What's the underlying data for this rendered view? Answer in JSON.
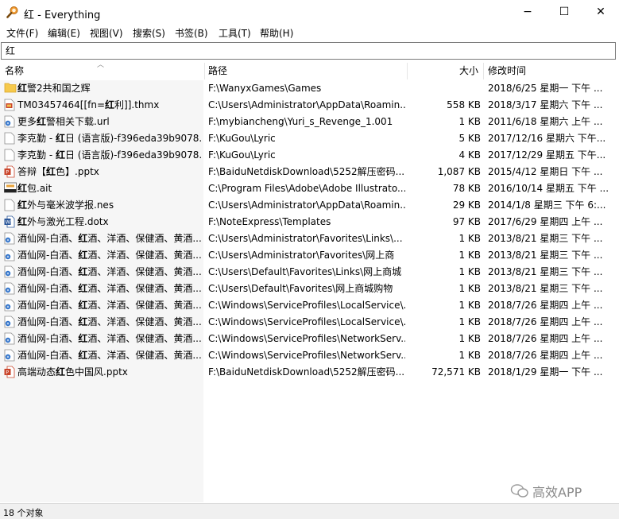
{
  "window": {
    "title": "红 - Everything",
    "minimize": "−",
    "maximize": "☐",
    "close": "✕"
  },
  "menu": [
    "文件(F)",
    "编辑(E)",
    "视图(V)",
    "搜索(S)",
    "书签(B)",
    "工具(T)",
    "帮助(H)"
  ],
  "search": {
    "value": "红"
  },
  "columns": {
    "name": "名称",
    "path": "路径",
    "size": "大小",
    "modified": "修改时间"
  },
  "rows": [
    {
      "icon": "folder-icon",
      "pre": "",
      "hl": "红",
      "post": "警2共和国之辉",
      "path": "F:\\WanyxGames\\Games",
      "size": "",
      "date": "2018/6/25 星期一 下午 ..."
    },
    {
      "icon": "theme-file-icon",
      "pre": "TM03457464[[fn=",
      "hl": "红",
      "post": "利]].thmx",
      "path": "C:\\Users\\Administrator\\AppData\\Roamin...",
      "size": "558 KB",
      "date": "2018/3/17 星期六 下午 ..."
    },
    {
      "icon": "url-file-icon",
      "pre": "更多",
      "hl": "红",
      "post": "警相关下载.url",
      "path": "F:\\mybiancheng\\Yuri_s_Revenge_1.001",
      "size": "1 KB",
      "date": "2011/6/18 星期六 上午 ..."
    },
    {
      "icon": "text-file-icon",
      "pre": "李克勤 - ",
      "hl": "红",
      "post": "日 (语言版)-f396eda39b9078...",
      "path": "F:\\KuGou\\Lyric",
      "size": "5 KB",
      "date": "2017/12/16 星期六 下午..."
    },
    {
      "icon": "text-file-icon",
      "pre": "李克勤 - ",
      "hl": "红",
      "post": "日 (语言版)-f396eda39b9078...",
      "path": "F:\\KuGou\\Lyric",
      "size": "4 KB",
      "date": "2017/12/29 星期五 下午..."
    },
    {
      "icon": "pptx-file-icon",
      "pre": "答辩【",
      "hl": "红",
      "post": "色】.pptx",
      "path": "F:\\BaiduNetdiskDownload\\5252解压密码...",
      "size": "1,087 KB",
      "date": "2015/4/12 星期日 下午 ..."
    },
    {
      "icon": "illustrator-file-icon",
      "pre": "",
      "hl": "红",
      "post": "包.ait",
      "path": "C:\\Program Files\\Adobe\\Adobe Illustrato...",
      "size": "78 KB",
      "date": "2016/10/14 星期五 下午 ..."
    },
    {
      "icon": "text-file-icon",
      "pre": "",
      "hl": "红",
      "post": "外与毫米波学报.nes",
      "path": "C:\\Users\\Administrator\\AppData\\Roamin...",
      "size": "29 KB",
      "date": "2014/1/8 星期三 下午 6:..."
    },
    {
      "icon": "word-file-icon",
      "pre": "",
      "hl": "红",
      "post": "外与激光工程.dotx",
      "path": "F:\\NoteExpress\\Templates",
      "size": "97 KB",
      "date": "2017/6/29 星期四 上午 ..."
    },
    {
      "icon": "url-file-icon",
      "pre": "酒仙网-白酒、",
      "hl": "红",
      "post": "酒、洋酒、保健酒、黄酒...",
      "path": "C:\\Users\\Administrator\\Favorites\\Links\\...",
      "size": "1 KB",
      "date": "2013/8/21 星期三 下午 ..."
    },
    {
      "icon": "url-file-icon",
      "pre": "酒仙网-白酒、",
      "hl": "红",
      "post": "酒、洋酒、保健酒、黄酒...",
      "path": "C:\\Users\\Administrator\\Favorites\\网上商",
      "size": "1 KB",
      "date": "2013/8/21 星期三 下午 ..."
    },
    {
      "icon": "url-file-icon",
      "pre": "酒仙网-白酒、",
      "hl": "红",
      "post": "酒、洋酒、保健酒、黄酒...",
      "path": "C:\\Users\\Default\\Favorites\\Links\\网上商城",
      "size": "1 KB",
      "date": "2013/8/21 星期三 下午 ..."
    },
    {
      "icon": "url-file-icon",
      "pre": "酒仙网-白酒、",
      "hl": "红",
      "post": "酒、洋酒、保健酒、黄酒...",
      "path": "C:\\Users\\Default\\Favorites\\网上商城购物",
      "size": "1 KB",
      "date": "2013/8/21 星期三 下午 ..."
    },
    {
      "icon": "url-file-icon",
      "pre": "酒仙网-白酒、",
      "hl": "红",
      "post": "酒、洋酒、保健酒、黄酒...",
      "path": "C:\\Windows\\ServiceProfiles\\LocalService\\...",
      "size": "1 KB",
      "date": "2018/7/26 星期四 上午 ..."
    },
    {
      "icon": "url-file-icon",
      "pre": "酒仙网-白酒、",
      "hl": "红",
      "post": "酒、洋酒、保健酒、黄酒...",
      "path": "C:\\Windows\\ServiceProfiles\\LocalService\\...",
      "size": "1 KB",
      "date": "2018/7/26 星期四 上午 ..."
    },
    {
      "icon": "url-file-icon",
      "pre": "酒仙网-白酒、",
      "hl": "红",
      "post": "酒、洋酒、保健酒、黄酒...",
      "path": "C:\\Windows\\ServiceProfiles\\NetworkServ...",
      "size": "1 KB",
      "date": "2018/7/26 星期四 上午 ..."
    },
    {
      "icon": "url-file-icon",
      "pre": "酒仙网-白酒、",
      "hl": "红",
      "post": "酒、洋酒、保健酒、黄酒...",
      "path": "C:\\Windows\\ServiceProfiles\\NetworkServ...",
      "size": "1 KB",
      "date": "2018/7/26 星期四 上午 ..."
    },
    {
      "icon": "pptx-file-icon",
      "pre": "高端动态",
      "hl": "红",
      "post": "色中国风.pptx",
      "path": "F:\\BaiduNetdiskDownload\\5252解压密码...",
      "size": "72,571 KB",
      "date": "2018/1/29 星期一 下午 ..."
    }
  ],
  "status": {
    "text": "18 个对象"
  },
  "watermark": {
    "text": "高效APP"
  },
  "colors": {
    "folder": "#f6c94b",
    "url": "#2a6fc9",
    "pptx": "#c9452b",
    "word": "#2b579a",
    "theme": "#c9452b"
  }
}
